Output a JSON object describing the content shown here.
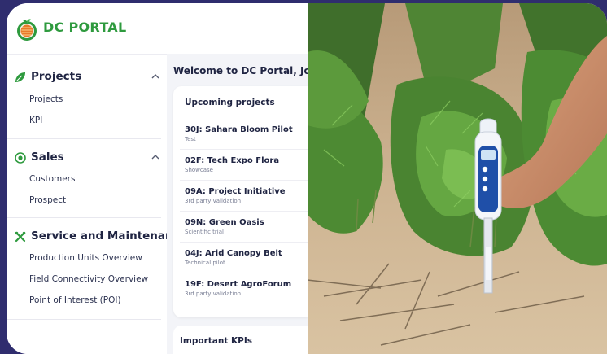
{
  "brand": {
    "name": "DC PORTAL"
  },
  "colors": {
    "brand_green": "#2e9a3e",
    "background": "#2f2d6e",
    "text": "#1f2442"
  },
  "sidebar": {
    "sections": [
      {
        "title": "Projects",
        "icon": "leaf-icon",
        "expanded": true,
        "items": [
          "Projects",
          "KPI"
        ]
      },
      {
        "title": "Sales",
        "icon": "target-icon",
        "expanded": true,
        "items": [
          "Customers",
          "Prospect"
        ]
      },
      {
        "title": "Service and Maintenance",
        "icon": "tools-icon",
        "items": [
          "Production Units Overview",
          "Field Connectivity Overview",
          "Point of Interest (POI)"
        ]
      }
    ]
  },
  "main": {
    "welcome": "Welcome to DC Portal, Joe!",
    "upcoming": {
      "title": "Upcoming projects",
      "projects": [
        {
          "name": "30J: Sahara Bloom Pilot",
          "type": "Test"
        },
        {
          "name": "02F: Tech Expo Flora",
          "type": "Showcase"
        },
        {
          "name": "09A: Project Initiative",
          "type": "3rd party validation"
        },
        {
          "name": "09N: Green Oasis",
          "type": "Scientific trial"
        },
        {
          "name": "04J: Arid Canopy Belt",
          "type": "Technical pilot"
        },
        {
          "name": "19F: Desert AgroForum",
          "type": "3rd party validation"
        }
      ]
    },
    "kpis": {
      "title": "Important KPIs"
    }
  },
  "photo": {
    "subject": "hand holding soil meter probe in sandy soil between rows of carrot seedlings"
  }
}
